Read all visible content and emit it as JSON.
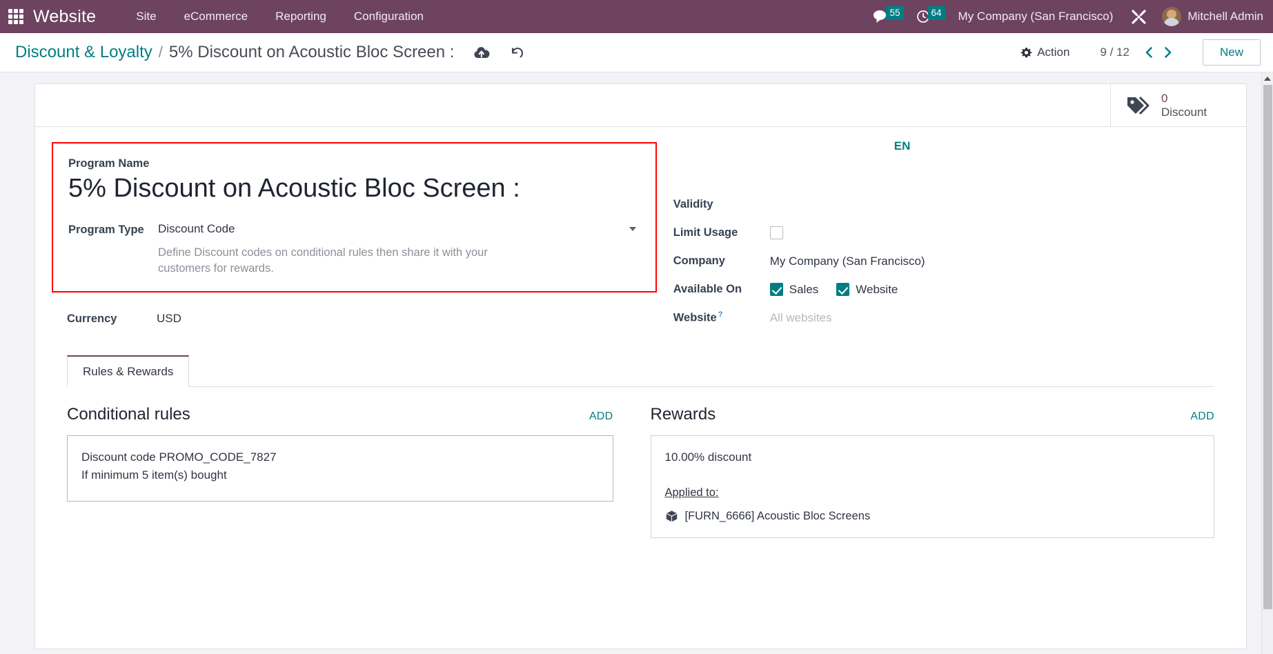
{
  "navbar": {
    "apps_icon": "apps-grid-icon",
    "brand": "Website",
    "menu": [
      {
        "label": "Site"
      },
      {
        "label": "eCommerce"
      },
      {
        "label": "Reporting"
      },
      {
        "label": "Configuration"
      }
    ],
    "messages_icon": "messages-icon",
    "messages_count": "55",
    "activities_icon": "clock-icon",
    "activities_count": "64",
    "company": "My Company (San Francisco)",
    "tools_icon": "tools-icon",
    "avatar_icon": "user-avatar",
    "user": "Mitchell Admin",
    "bg_color": "#6d4360",
    "badge_color": "#017e84"
  },
  "control_panel": {
    "breadcrumb_parent": "Discount & Loyalty",
    "breadcrumb_separator": "/",
    "breadcrumb_current": "5% Discount on Acoustic Bloc Screen :",
    "save_icon": "cloud-upload-icon",
    "discard_icon": "undo-icon",
    "action_icon": "gear-icon",
    "action_label": "Action",
    "pager_text": "9 / 12",
    "pager_prev_icon": "chevron-left-icon",
    "pager_next_icon": "chevron-right-icon",
    "new_label": "New",
    "accent_color": "#017e84"
  },
  "stat_buttons": [
    {
      "icon": "tags-icon",
      "value": "0",
      "label": "Discount"
    }
  ],
  "form": {
    "program_name_label": "Program Name",
    "program_name_value": "5% Discount on Acoustic Bloc Screen :",
    "program_type_label": "Program Type",
    "program_type_value": "Discount Code",
    "program_type_help": "Define Discount codes on conditional rules then share it with your customers for rewards.",
    "currency_label": "Currency",
    "currency_value": "USD",
    "highlight_color": "#ff0000",
    "lang_badge": "EN",
    "validity_label": "Validity",
    "validity_value": "",
    "limit_usage_label": "Limit Usage",
    "limit_usage_checked": false,
    "company_label": "Company",
    "company_value": "My Company (San Francisco)",
    "available_on_label": "Available On",
    "available_on": [
      {
        "label": "Sales",
        "checked": true
      },
      {
        "label": "Website",
        "checked": true
      }
    ],
    "website_label": "Website",
    "website_help_marker": "?",
    "website_placeholder": "All websites"
  },
  "notebook": {
    "tabs": [
      {
        "label": "Rules & Rewards",
        "active": true
      }
    ],
    "conditional_rules": {
      "title": "Conditional rules",
      "add_label": "ADD",
      "items": [
        {
          "line1": "Discount code PROMO_CODE_7827",
          "line2": "If minimum 5 item(s) bought"
        }
      ]
    },
    "rewards": {
      "title": "Rewards",
      "add_label": "ADD",
      "items": [
        {
          "line1": "10.00% discount",
          "applied_to_label": "Applied to:",
          "product_icon": "cube-icon",
          "product": "[FURN_6666] Acoustic Bloc Screens"
        }
      ]
    }
  },
  "scrollbar": {
    "up_icon": "scroll-up-icon"
  }
}
